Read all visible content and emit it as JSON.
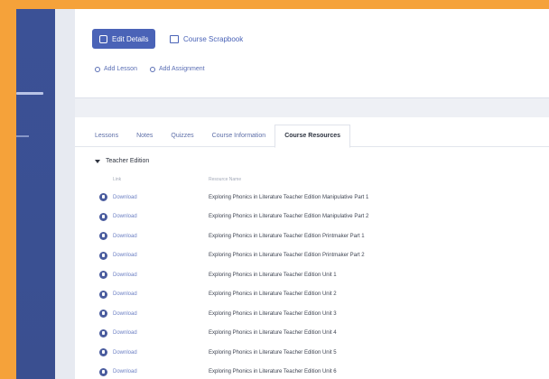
{
  "toolbar": {
    "primary_label": "Edit Details",
    "secondary_label": "Course Scrapbook"
  },
  "quick_links": [
    {
      "label": "Add Lesson"
    },
    {
      "label": "Add Assignment"
    }
  ],
  "tabs": [
    {
      "label": "Lessons"
    },
    {
      "label": "Notes"
    },
    {
      "label": "Quizzes"
    },
    {
      "label": "Course Information"
    },
    {
      "label": "Course Resources",
      "active": true
    }
  ],
  "section": {
    "title": "Teacher Edition"
  },
  "table": {
    "headers": [
      "Link",
      "Resource Name"
    ],
    "rows": [
      {
        "action": "Download",
        "name": "Exploring Phonics in Literature Teacher Edition Manipulative Part 1"
      },
      {
        "action": "Download",
        "name": "Exploring Phonics in Literature Teacher Edition Manipulative Part 2"
      },
      {
        "action": "Download",
        "name": "Exploring Phonics in Literature Teacher Edition Printmaker Part 1"
      },
      {
        "action": "Download",
        "name": "Exploring Phonics in Literature Teacher Edition Printmaker Part 2"
      },
      {
        "action": "Download",
        "name": "Exploring Phonics in Literature Teacher Edition Unit 1"
      },
      {
        "action": "Download",
        "name": "Exploring Phonics in Literature Teacher Edition Unit 2"
      },
      {
        "action": "Download",
        "name": "Exploring Phonics in Literature Teacher Edition Unit 3"
      },
      {
        "action": "Download",
        "name": "Exploring Phonics in Literature Teacher Edition Unit 4"
      },
      {
        "action": "Download",
        "name": "Exploring Phonics in Literature Teacher Edition Unit 5"
      },
      {
        "action": "Download",
        "name": "Exploring Phonics in Literature Teacher Edition Unit 6"
      }
    ]
  },
  "colors": {
    "border": "#f5a23a",
    "sidebar": "#3b5196",
    "accent": "#4a63b7"
  }
}
